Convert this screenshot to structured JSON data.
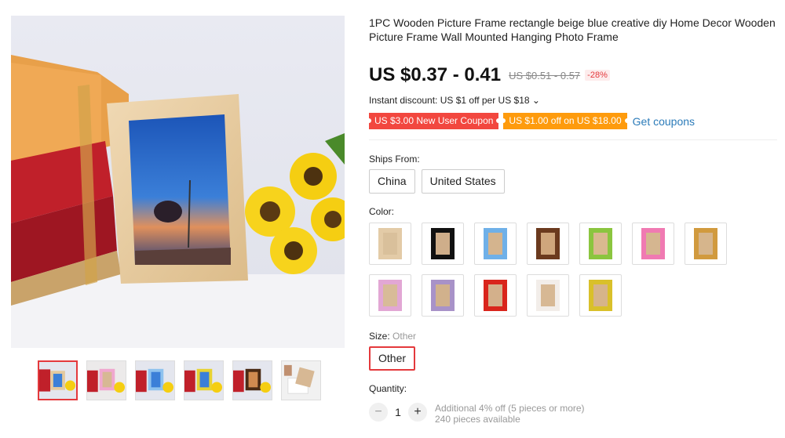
{
  "product": {
    "title": "1PC Wooden Picture Frame rectangle beige blue creative diy Home Decor Wooden Picture Frame Wall Mounted Hanging Photo Frame",
    "price": "US $0.37 - 0.41",
    "original_price": "US $0.51 - 0.57",
    "discount": "-28%"
  },
  "promotions": {
    "instant_discount": "Instant discount: US $1 off per US $18 ⌄",
    "coupon_new_user": "US $3.00 New User Coupon",
    "coupon_off": "US $1.00 off on US $18.00",
    "get_coupons": "Get coupons"
  },
  "ships_from": {
    "label": "Ships From:",
    "options": [
      "China",
      "United States"
    ]
  },
  "color": {
    "label": "Color:",
    "swatches": [
      {
        "frame": "#e3cba7",
        "photo": "#d9c09b"
      },
      {
        "frame": "#111111",
        "photo": "#cfae8a"
      },
      {
        "frame": "#6fb0e8",
        "photo": "#d4b48e"
      },
      {
        "frame": "#6b3a1e",
        "photo": "#cfa67c"
      },
      {
        "frame": "#8bc53f",
        "photo": "#d9b98f"
      },
      {
        "frame": "#f07ab2",
        "photo": "#d5b690"
      },
      {
        "frame": "#d19a3e",
        "photo": "#d6b58c"
      },
      {
        "frame": "#e2a7d4",
        "photo": "#d8bb98"
      },
      {
        "frame": "#a892c8",
        "photo": "#d1b18c"
      },
      {
        "frame": "#d9251c",
        "photo": "#d3b08b"
      },
      {
        "frame": "#f2ede9",
        "photo": "#d7b894"
      },
      {
        "frame": "#d9c02a",
        "photo": "#d6b48a"
      }
    ]
  },
  "size": {
    "label": "Size:",
    "selected": "Other",
    "option": "Other"
  },
  "quantity": {
    "label": "Quantity:",
    "minus": "−",
    "value": "1",
    "plus": "+",
    "note_discount": "Additional 4% off (5 pieces or more)",
    "note_available": "240 pieces available"
  },
  "colors": {
    "accent_red": "#e4393c",
    "link_blue": "#2b7bb9",
    "coupon_red": "#f2473f",
    "coupon_orange": "#fe9b0d"
  }
}
